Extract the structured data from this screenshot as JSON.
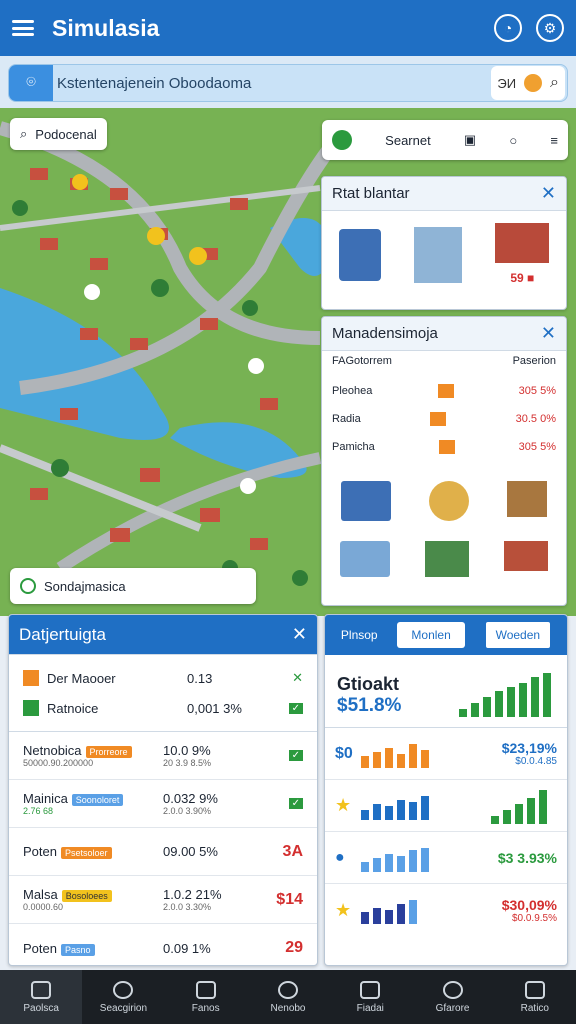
{
  "app": {
    "title": "Simulasia"
  },
  "search": {
    "text": "Kstentenajenein Oboodaoma",
    "right_text": "ЭИ"
  },
  "map": {
    "location_label": "Podocenal",
    "bottom_label": "Sondajmasica",
    "toolbar_label": "Searnet"
  },
  "stat_panel": {
    "title": "Rtat blantar",
    "value": "59 ■"
  },
  "manage_panel": {
    "title": "Manadensimoja",
    "col_left": "FAGotorrem",
    "col_right": "Paserion",
    "rows": [
      {
        "label": "Pleohea",
        "val1": "305",
        "val2": "5%"
      },
      {
        "label": "Radia",
        "val1": "30.5",
        "val2": "0%"
      },
      {
        "label": "Pamicha",
        "val1": "305",
        "val2": "5%"
      }
    ]
  },
  "data_panel": {
    "title": "Datjertuigta",
    "summary": [
      {
        "label": "Der Maooer",
        "value": "0.13"
      },
      {
        "label": "Ratnoice",
        "value": "0,001 3%"
      }
    ],
    "rows": [
      {
        "name": "Netnobica",
        "sub": "50000.90.200000",
        "tag": "Prorreore",
        "value": "10.0 9%",
        "sub_value": "20 3.9 8.5%",
        "flag": "✓"
      },
      {
        "name": "Mainica",
        "sub": "2.76 68",
        "tag": "Soonoloret",
        "value": "0.032 9%",
        "sub_value": "2.0.0 3.90%",
        "flag": "✓"
      },
      {
        "name": "Poten",
        "sub": "",
        "tag": "Psetsoloer",
        "value": "09.00 5%",
        "sub_value": "",
        "flag": "3А"
      },
      {
        "name": "Malsa",
        "sub": "0.0000.60",
        "tag": "Bosoloees",
        "value": "1.0.2 21%",
        "sub_value": "2.0.0 3.30%",
        "flag": "$14"
      },
      {
        "name": "Poten",
        "sub": "",
        "tag": "Pasno",
        "value": "0.09 1%",
        "sub_value": "",
        "flag": "29"
      }
    ]
  },
  "stock_panel": {
    "tabs": [
      "Plnsop",
      "Monlen",
      "Woeden"
    ],
    "title": "Gtioakt",
    "price": "$51.8%",
    "rows": [
      {
        "icon": "$0",
        "value": "$23,19%",
        "sub": "$0.0.4.85"
      },
      {
        "icon": "★",
        "value": "",
        "sub": ""
      },
      {
        "icon": "●",
        "value": "$3 3.93%",
        "sub": ""
      },
      {
        "icon": "★",
        "value": "$30,09%",
        "sub": "$0.0.9.5%"
      }
    ]
  },
  "nav": [
    "Paolsca",
    "Seacgirion",
    "Fanos",
    "Nenobo",
    "Fiadai",
    "Gfarore",
    "Ratico"
  ],
  "colors": {
    "primary": "#1f6fc4",
    "green": "#2b9a3e",
    "red": "#d32f2f",
    "orange": "#f08a24"
  }
}
